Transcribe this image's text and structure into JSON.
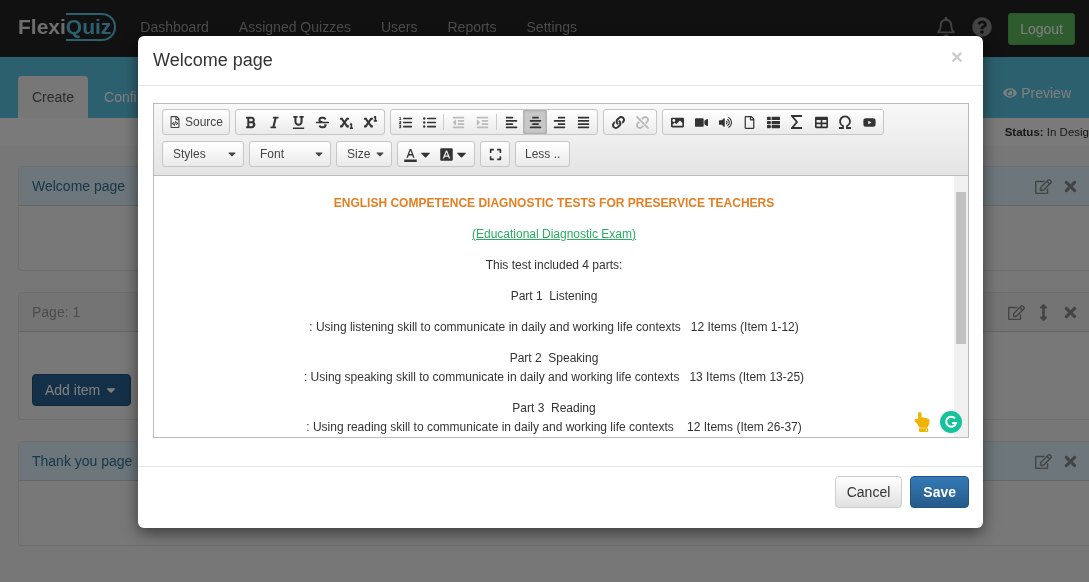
{
  "navbar": {
    "brand_prefix": "Flexi",
    "brand_suffix": "Quiz",
    "items": [
      "Dashboard",
      "Assigned Quizzes",
      "Users",
      "Reports",
      "Settings"
    ],
    "logout": "Logout"
  },
  "tabs": [
    {
      "label": "Create",
      "selected": true
    },
    {
      "label": "Confi",
      "selected": false
    }
  ],
  "preview": "Preview",
  "status": "**Status:** In Desig",
  "cards": [
    {
      "kind": "section",
      "title": "Welcome page"
    },
    {
      "kind": "page",
      "title": "Page: 1",
      "button": "Add item"
    },
    {
      "kind": "section",
      "title": "Thank you page"
    }
  ],
  "modal": {
    "title": "Welcome page",
    "close": "×",
    "toolbar": {
      "source": "Source",
      "buttons": [
        {
          "selected": false,
          "disabled": false
        },
        {
          "selected": false,
          "disabled": false
        },
        {
          "selected": false,
          "disabled": false
        },
        {
          "selected": false,
          "disabled": false
        },
        {
          "selected": false,
          "disabled": false
        },
        {
          "selected": false,
          "disabled": false
        },
        {
          "selected": false,
          "disabled": false
        },
        {
          "selected": false,
          "disabled": false
        },
        {
          "selected": false,
          "disabled": true
        },
        {
          "selected": false,
          "disabled": true
        },
        {
          "selected": false,
          "disabled": false
        },
        {
          "selected": true,
          "disabled": false
        },
        {
          "selected": false,
          "disabled": false
        },
        {
          "selected": false,
          "disabled": false
        },
        {
          "selected": false,
          "disabled": false
        },
        {
          "selected": false,
          "disabled": true
        },
        {
          "selected": false,
          "disabled": false
        },
        {
          "selected": false,
          "disabled": false
        },
        {
          "selected": false,
          "disabled": false
        },
        {
          "selected": false,
          "disabled": false
        },
        {
          "selected": false,
          "disabled": false
        },
        {
          "selected": false,
          "disabled": false
        },
        {
          "selected": false,
          "disabled": false
        },
        {
          "selected": false,
          "disabled": false
        },
        {
          "selected": false,
          "disabled": false
        }
      ],
      "combos": [
        "Styles",
        "Font",
        "Size"
      ],
      "less": "Less .."
    },
    "paragraphs": [
      {
        "kind": "heading",
        "lines": [
          "ENGLISH COMPETENCE DIAGNOSTIC TESTS FOR PRESERVICE TEACHERS"
        ]
      },
      {
        "kind": "link",
        "lines": [
          "(Educational Diagnostic Exam)"
        ]
      },
      {
        "kind": "text",
        "lines": [
          "This test included 4 parts:"
        ]
      },
      {
        "kind": "text",
        "lines": [
          "Part 1  Listening"
        ]
      },
      {
        "kind": "text",
        "lines": [
          ": Using listening skill to communicate in daily and working life contexts   12 Items (Item 1-12)"
        ]
      },
      {
        "kind": "text",
        "lines": [
          "Part 2  Speaking",
          ": Using speaking skill to communicate in daily and working life contexts   13 Items (Item 13-25)"
        ]
      },
      {
        "kind": "text",
        "lines": [
          "Part 3  Reading",
          ": Using reading skill to communicate in daily and working life contexts    12 Items (Item 26-37)"
        ]
      }
    ],
    "cancel": "Cancel",
    "save": "Save"
  }
}
